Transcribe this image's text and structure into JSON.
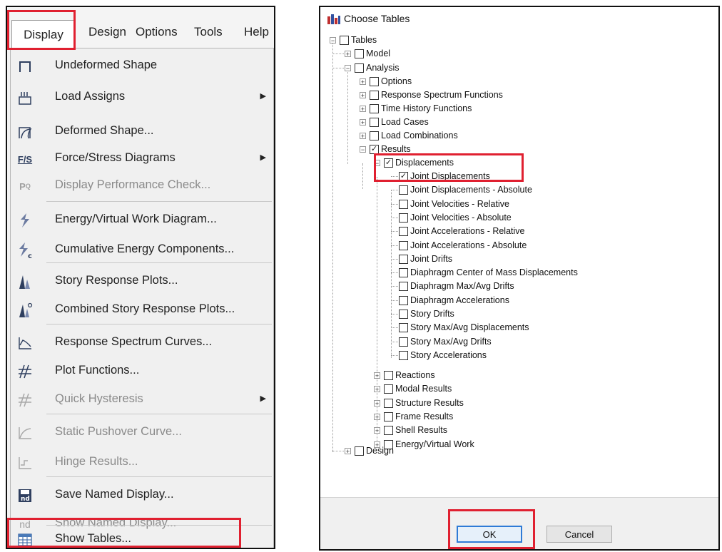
{
  "menubar": {
    "items": [
      "Display",
      "Design",
      "Options",
      "Tools",
      "Help"
    ]
  },
  "menu": {
    "items": [
      {
        "label": "Undeformed Shape",
        "icon": "undeformed-shape-icon",
        "disabled": false,
        "submenu": false
      },
      {
        "label": "Load Assigns",
        "icon": "load-assigns-icon",
        "disabled": false,
        "submenu": true
      },
      {
        "label": "Deformed Shape...",
        "icon": "deformed-shape-icon",
        "disabled": false,
        "submenu": false
      },
      {
        "label": "Force/Stress Diagrams",
        "icon": "force-stress-icon",
        "disabled": false,
        "submenu": true
      },
      {
        "label": "Display Performance Check...",
        "icon": "performance-check-icon",
        "disabled": true,
        "submenu": false
      },
      {
        "label": "Energy/Virtual Work Diagram...",
        "icon": "energy-diagram-icon",
        "disabled": false,
        "submenu": false
      },
      {
        "label": "Cumulative Energy Components...",
        "icon": "cumulative-energy-icon",
        "disabled": false,
        "submenu": false
      },
      {
        "label": "Story Response Plots...",
        "icon": "story-response-icon",
        "disabled": false,
        "submenu": false
      },
      {
        "label": "Combined Story Response Plots...",
        "icon": "combined-story-icon",
        "disabled": false,
        "submenu": false
      },
      {
        "label": "Response Spectrum Curves...",
        "icon": "response-spectrum-icon",
        "disabled": false,
        "submenu": false
      },
      {
        "label": "Plot Functions...",
        "icon": "plot-functions-icon",
        "disabled": false,
        "submenu": false
      },
      {
        "label": "Quick Hysteresis",
        "icon": "hysteresis-icon",
        "disabled": true,
        "submenu": true
      },
      {
        "label": "Static Pushover Curve...",
        "icon": "pushover-curve-icon",
        "disabled": true,
        "submenu": false
      },
      {
        "label": "Hinge Results...",
        "icon": "hinge-results-icon",
        "disabled": true,
        "submenu": false
      },
      {
        "label": "Save Named Display...",
        "icon": "save-named-display-icon",
        "disabled": false,
        "submenu": false
      },
      {
        "label": "Show Named Display...",
        "icon": "show-named-display-icon",
        "disabled": true,
        "submenu": false
      },
      {
        "label": "Show Tables...",
        "icon": "show-tables-icon",
        "disabled": false,
        "submenu": false
      }
    ]
  },
  "dialog": {
    "title": "Choose Tables",
    "tree": {
      "root": "Tables",
      "model": "Model",
      "analysis": "Analysis",
      "options": "Options",
      "response_spectrum": "Response Spectrum Functions",
      "time_history": "Time History Functions",
      "load_cases": "Load Cases",
      "load_combinations": "Load Combinations",
      "results": "Results",
      "displacements": "Displacements",
      "displacement_items": [
        {
          "label": "Joint Displacements",
          "checked": true
        },
        {
          "label": "Joint Displacements - Absolute",
          "checked": false
        },
        {
          "label": "Joint Velocities - Relative",
          "checked": false
        },
        {
          "label": "Joint Velocities - Absolute",
          "checked": false
        },
        {
          "label": "Joint Accelerations - Relative",
          "checked": false
        },
        {
          "label": "Joint Accelerations - Absolute",
          "checked": false
        },
        {
          "label": "Joint Drifts",
          "checked": false
        },
        {
          "label": "Diaphragm Center of Mass Displacements",
          "checked": false
        },
        {
          "label": "Diaphragm Max/Avg Drifts",
          "checked": false
        },
        {
          "label": "Diaphragm Accelerations",
          "checked": false
        },
        {
          "label": "Story Drifts",
          "checked": false
        },
        {
          "label": "Story Max/Avg Displacements",
          "checked": false
        },
        {
          "label": "Story Max/Avg Drifts",
          "checked": false
        },
        {
          "label": "Story Accelerations",
          "checked": false
        }
      ],
      "result_groups": [
        "Reactions",
        "Modal Results",
        "Structure Results",
        "Frame Results",
        "Shell Results",
        "Energy/Virtual Work"
      ],
      "design": "Design"
    },
    "ok_label": "OK",
    "cancel_label": "Cancel"
  },
  "colors": {
    "highlight": "#e02030",
    "ok_border": "#2f7bd6"
  }
}
